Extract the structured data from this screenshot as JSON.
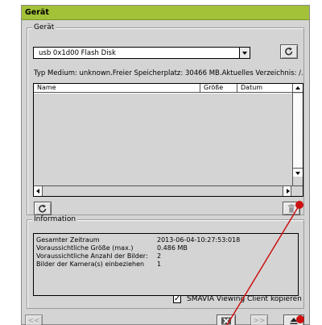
{
  "window": {
    "title": "Gerät"
  },
  "device_group": {
    "legend": "Gerät",
    "selected_device": "usb 0x1d00 Flash Disk",
    "status_line": "Typ Medium: unknown.Freier Speicherplatz: 30466 MB.Aktuelles Verzeichnis: /.",
    "columns": [
      "Name",
      "Größe",
      "Datum"
    ]
  },
  "info_group": {
    "legend": "Information",
    "rows": [
      {
        "label": "Gesamter Zeitraum",
        "value": "2013-06-04-10:27:53:018"
      },
      {
        "label": "Voraussichtliche Größe (max.)",
        "value": "0.486 MB"
      },
      {
        "label": "Voraussichtliche Anzahl der Bilder:",
        "value": "2"
      },
      {
        "label": "Bilder der Kamera(s) einbeziehen",
        "value": "1"
      }
    ]
  },
  "checkbox": {
    "label": "SMAVIA Viewing Client kopieren",
    "checked": true
  },
  "buttons": {
    "first": "<<",
    "next": ">>"
  },
  "icons": {
    "refresh": "refresh-icon",
    "delete": "trash-icon",
    "cancel": "cancel-x-icon",
    "eject": "eject-icon"
  },
  "colors": {
    "titlebar": "#a3c238",
    "annotation": "#cc1111"
  }
}
